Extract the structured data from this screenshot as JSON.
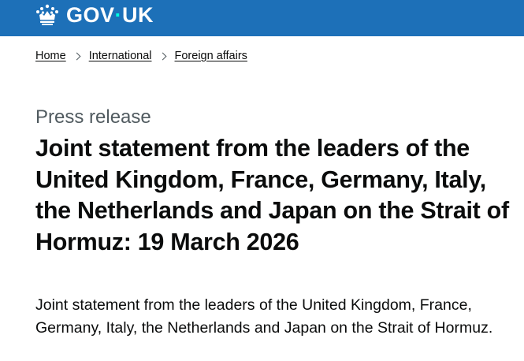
{
  "header": {
    "logo": {
      "crown_icon": "crown-icon",
      "wordmark_part1": "GOV",
      "wordmark_dot": "·",
      "wordmark_part2": "UK"
    },
    "colors": {
      "background": "#1d70b8",
      "text": "#ffffff"
    }
  },
  "breadcrumbs": [
    {
      "label": "Home"
    },
    {
      "label": "International"
    },
    {
      "label": "Foreign affairs"
    }
  ],
  "page": {
    "caption": "Press release",
    "title": "Joint statement from the leaders of the United Kingdom, France, Germany, Italy, the Netherlands and Japan on the Strait of Hormuz: 19 March 2026",
    "lede": "Joint statement from the leaders of the United Kingdom, France, Germany, Italy, the Netherlands and Japan on the Strait of Hormuz."
  }
}
